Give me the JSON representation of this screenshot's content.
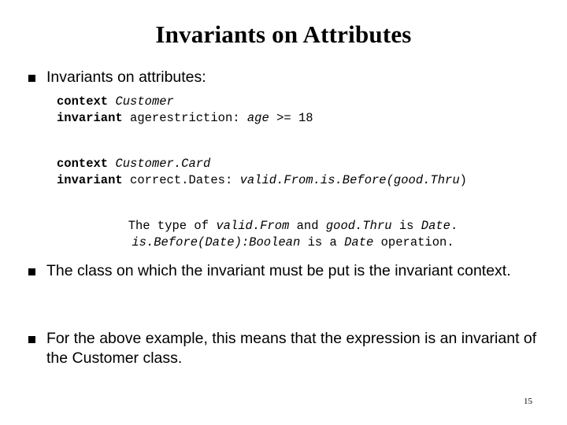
{
  "slide": {
    "title": "Invariants on Attributes",
    "page_number": "15",
    "bullets": [
      {
        "marker": "square-bullet",
        "text": "Invariants on attributes:"
      },
      {
        "marker": "square-bullet",
        "text": "The class on which the invariant must be put is the invariant context."
      },
      {
        "marker": "square-bullet",
        "text": "For the above example, this means that the expression is an invariant of the Customer class."
      }
    ],
    "code_block_1": {
      "line1_keyword": "context",
      "line1_value": "Customer",
      "line2_keyword": "invariant",
      "line2_name": "agerestriction:",
      "line2_expr_italic": "age",
      "line2_expr_rest": " >= 18"
    },
    "code_block_2": {
      "line1_keyword": "context",
      "line1_value": "Customer.Card",
      "line2_keyword": "invariant",
      "line2_name": "correct.Dates:",
      "line2_expr_italic": "valid.From.is.Before(good.Thru",
      "line2_expr_rest": ")"
    },
    "note": {
      "line1_a": "The type of ",
      "line1_b": "valid.From",
      "line1_c": " and ",
      "line1_d": "good.Thru",
      "line1_e": " is ",
      "line1_f": "Date",
      "line1_g": ".",
      "line2_a": "is.Before(Date):Boolean",
      "line2_b": " is a ",
      "line2_c": "Date",
      "line2_d": " operation."
    }
  }
}
